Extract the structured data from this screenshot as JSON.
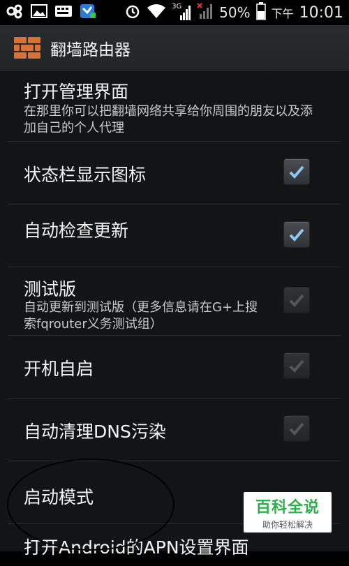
{
  "status_bar": {
    "icons_left": [
      "link-icon",
      "image-icon",
      "keyboard-icon",
      "app-notification-icon"
    ],
    "icons_right": [
      "alarm-icon",
      "wifi-icon",
      "3g-signal-icon",
      "no-signal-icon",
      "battery-icon"
    ],
    "network_label": "3G",
    "battery_percent": "50%",
    "ampm": "下午",
    "time": "10:01"
  },
  "action_bar": {
    "title": "翻墙路由器"
  },
  "settings": {
    "items": [
      {
        "title": "打开管理界面",
        "summary": "在那里你可以把翻墙网络共享给你周围的朋友以及添加自己的个人代理"
      },
      {
        "title": "状态栏显示图标",
        "checked": true,
        "enabled": true
      },
      {
        "title": "自动检查更新",
        "checked": true,
        "enabled": true
      },
      {
        "title": "测试版",
        "summary": "自动更新到测试版（更多信息请在G+上搜索fqrouter义务测试组）",
        "checked": true,
        "enabled": false
      },
      {
        "title": "开机自启",
        "checked": true,
        "enabled": false
      },
      {
        "title": "自动清理DNS污染",
        "checked": true,
        "enabled": false
      },
      {
        "title": "启动模式"
      },
      {
        "title": "打开Android的APN设置界面"
      }
    ]
  },
  "watermark": {
    "title": "百科全说",
    "subtitle": "助你轻松解决"
  },
  "colors": {
    "list_bg": "#131416",
    "checkmark_on": "#8ec8ee",
    "checkmark_off": "#8b8d91",
    "watermark_green": "#2bb14a"
  }
}
